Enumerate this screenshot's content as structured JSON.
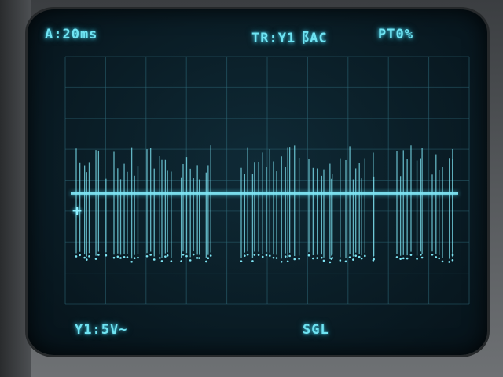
{
  "display": {
    "timebase": "A:20ms",
    "trigger": "TR:Y1⻏AC",
    "pretrigger": "PT0%",
    "channel": "Y1:5V~",
    "mode": "SGL"
  },
  "colors": {
    "trace": "#7fe6f5",
    "graticule": "#2f6a7a",
    "screen": "#0a1d26"
  },
  "icons": {
    "ground_marker": "crosshair-plus-icon"
  },
  "ground_marker_glyph": "+",
  "trace": {
    "baseline_fraction": 0.56,
    "burst_count": 11
  }
}
